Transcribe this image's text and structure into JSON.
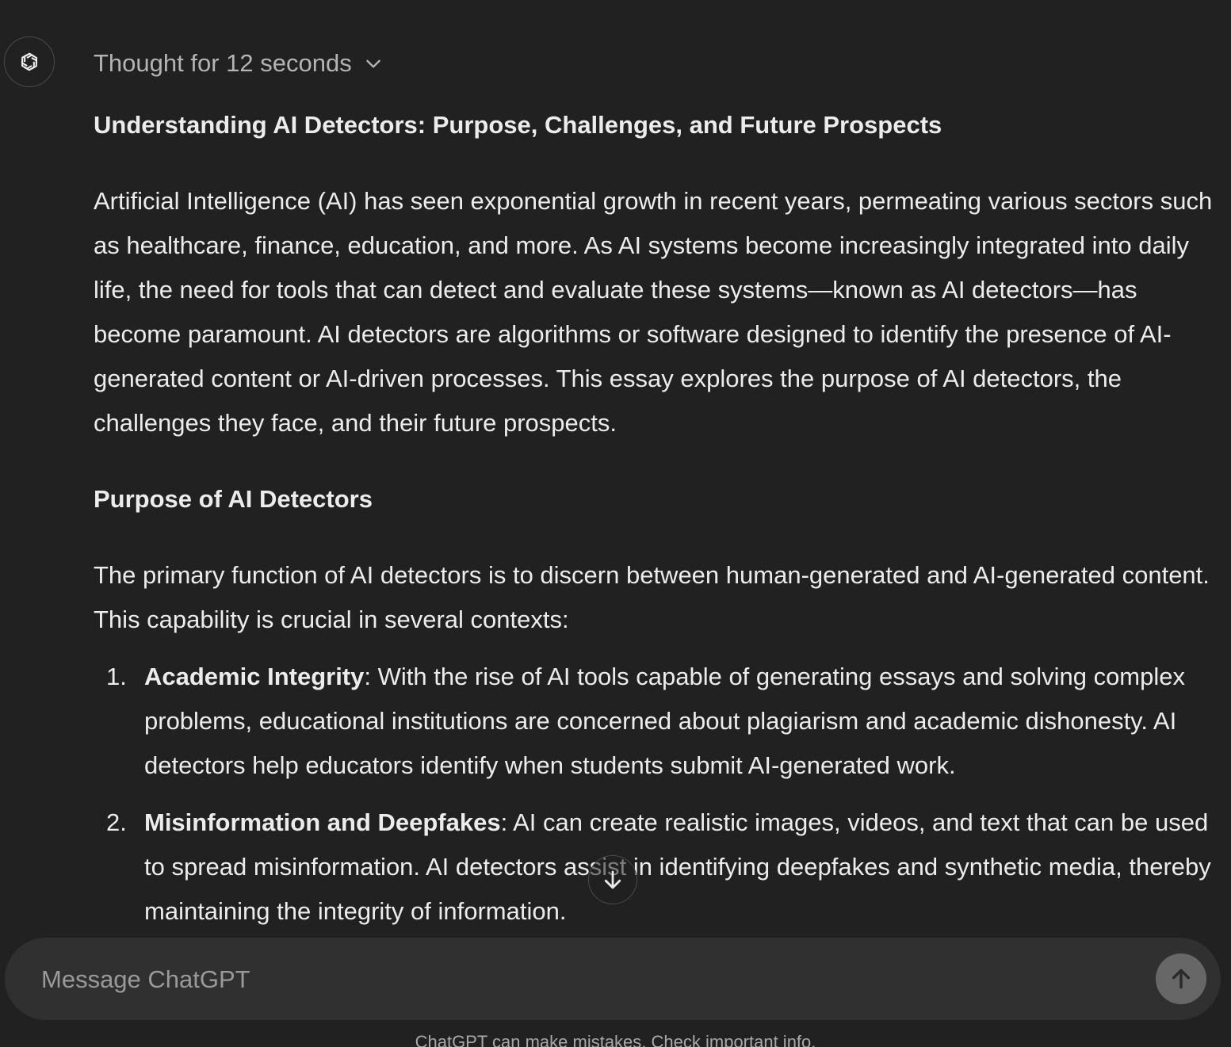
{
  "header": {
    "thought_label": "Thought for 12 seconds"
  },
  "message": {
    "title": "Understanding AI Detectors: Purpose, Challenges, and Future Prospects",
    "intro": "Artificial Intelligence (AI) has seen exponential growth in recent years, permeating various sectors such as healthcare, finance, education, and more. As AI systems become increasingly integrated into daily life, the need for tools that can detect and evaluate these systems—known as AI detectors—has become paramount. AI detectors are algorithms or software designed to identify the presence of AI-generated content or AI-driven processes. This essay explores the purpose of AI detectors, the challenges they face, and their future prospects.",
    "section_heading": "Purpose of AI Detectors",
    "section_intro": "The primary function of AI detectors is to discern between human-generated and AI-generated content. This capability is crucial in several contexts:",
    "items": [
      {
        "number": "1.",
        "term": "Academic Integrity",
        "text": ": With the rise of AI tools capable of generating essays and solving complex problems, educational institutions are concerned about plagiarism and academic dishonesty. AI detectors help educators identify when students submit AI-generated work."
      },
      {
        "number": "2.",
        "term": "Misinformation and Deepfakes",
        "text": ": AI can create realistic images, videos, and text that can be used to spread misinformation. AI detectors assist in identifying deepfakes and synthetic media, thereby maintaining the integrity of information."
      }
    ]
  },
  "composer": {
    "placeholder": "Message ChatGPT"
  },
  "footer": {
    "disclaimer": "ChatGPT can make mistakes. Check important info."
  },
  "icons": {
    "avatar": "openai-logo-icon",
    "thought_toggle": "chevron-down-icon",
    "scroll": "arrow-down-icon",
    "send": "arrow-up-icon"
  },
  "colors": {
    "background": "#212121",
    "composer": "#303030",
    "send_button": "#676767",
    "text": "#ececec",
    "muted": "#b4b4b4"
  }
}
